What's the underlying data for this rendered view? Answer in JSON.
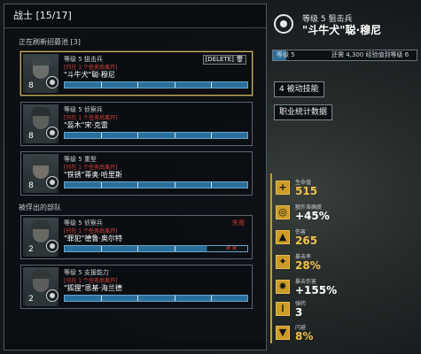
{
  "roster": {
    "title": "战士 [15/17]",
    "section_recruit": "正在刷新招募池 [3]",
    "section_captured": "被俘出的部队",
    "delete_label": "[DELETE] 🗑",
    "soldiers": [
      {
        "rank": "8",
        "line1": "等级 5 狙击兵",
        "status": "[只在 1 个任务后离开]",
        "name": "\"斗牛犬\"聪·穆尼",
        "xp": 1.0
      },
      {
        "rank": "8",
        "line1": "等级 5 侦察兵",
        "status": "[只在 1 个任务后离开]",
        "name": "\"盔木\"宋·克雷",
        "xp": 1.0
      },
      {
        "rank": "8",
        "line1": "等级 5 重型",
        "status": "[只在 1 个任务后离开]",
        "name": "\"铁锈\"蒂奥·哈里斯",
        "xp": 1.0
      },
      {
        "rank": "2",
        "line1": "等级 5 侦察兵",
        "status": "[只在 1 个任务后离开]",
        "name": "\"罪犯\"德鲁·奥尔特",
        "xp": 0.78,
        "tag": "失而",
        "mark": "✕✕"
      },
      {
        "rank": "2",
        "line1": "等级 5 支援能力",
        "status": "[只在 1 个任务后离开]",
        "name": "\"狐狸\"恩基·海兰德",
        "xp": 1.0
      }
    ]
  },
  "detail": {
    "class_line": "等级 5 狙击兵",
    "name": "\"斗牛犬\"聪·穆尼",
    "xp_level": "等级 5",
    "xp_text": "还需 4,300 经验值到等级 6",
    "xp_progress": 0.09,
    "button_passives": "4 被动技能",
    "button_stats": "职业统计数据"
  },
  "stats": [
    {
      "icon": "plus-icon",
      "glyph": "+",
      "label": "生命值",
      "value": "515"
    },
    {
      "icon": "crosshair-icon",
      "glyph": "◎",
      "label": "额外准确度",
      "value": "+45%"
    },
    {
      "icon": "damage-icon",
      "glyph": "▲",
      "label": "伤害",
      "value": "265"
    },
    {
      "icon": "crit-icon",
      "glyph": "✦",
      "label": "暴击率",
      "value": "28%"
    },
    {
      "icon": "crit-damage-icon",
      "glyph": "✸",
      "label": "暴击伤害",
      "value": "+155%"
    },
    {
      "icon": "ammo-icon",
      "glyph": "⁞",
      "label": "弹药",
      "value": "3"
    },
    {
      "icon": "dodge-icon",
      "glyph": "▼",
      "label": "闪避",
      "value": "8%"
    }
  ],
  "colors": {
    "accent": "#cc9c28",
    "selected_border": "#cdb15a",
    "xp_blue": "#2a6f9c",
    "warning_red": "#e0413a"
  }
}
